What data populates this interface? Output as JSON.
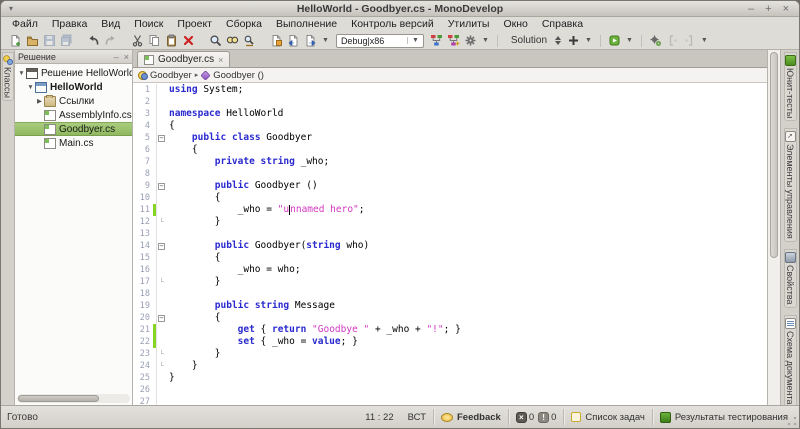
{
  "window": {
    "title": "HelloWorld - Goodbyer.cs - MonoDevelop",
    "minimize": "–",
    "maximize": "+",
    "close": "×",
    "menu_glyph": "▾"
  },
  "menubar": {
    "items": [
      "Файл",
      "Правка",
      "Вид",
      "Поиск",
      "Проект",
      "Сборка",
      "Выполнение",
      "Контроль версий",
      "Утилиты",
      "Окно",
      "Справка"
    ]
  },
  "toolbar": {
    "debug_config": "Debug|x86",
    "solution_label": "Solution",
    "items": [
      {
        "t": "i",
        "n": "new-file-icon"
      },
      {
        "t": "i",
        "n": "open-file-icon"
      },
      {
        "t": "i",
        "n": "save-icon",
        "d": 1
      },
      {
        "t": "i",
        "n": "save-all-icon",
        "d": 1
      },
      {
        "t": "gap"
      },
      {
        "t": "i",
        "n": "undo-icon"
      },
      {
        "t": "i",
        "n": "redo-icon",
        "d": 1
      },
      {
        "t": "gap"
      },
      {
        "t": "i",
        "n": "cut-icon"
      },
      {
        "t": "i",
        "n": "copy-icon"
      },
      {
        "t": "i",
        "n": "paste-icon"
      },
      {
        "t": "i",
        "n": "delete-icon"
      },
      {
        "t": "gap"
      },
      {
        "t": "i",
        "n": "search-icon"
      },
      {
        "t": "i",
        "n": "find-in-files-icon"
      },
      {
        "t": "i",
        "n": "find-replace-icon"
      },
      {
        "t": "gap"
      },
      {
        "t": "i",
        "n": "file-history-icon"
      },
      {
        "t": "i",
        "n": "prev-document-icon"
      },
      {
        "t": "i",
        "n": "next-document-icon"
      },
      {
        "t": "dd",
        "n": "navigation-dropdown-icon"
      },
      {
        "t": "combo"
      },
      {
        "t": "i",
        "n": "debug-threads-icon"
      },
      {
        "t": "i",
        "n": "debug-callstack-icon"
      },
      {
        "t": "i",
        "n": "gear-icon"
      },
      {
        "t": "dd",
        "n": "run-options-dropdown-icon"
      },
      {
        "t": "sep"
      },
      {
        "t": "sol"
      },
      {
        "t": "spin"
      },
      {
        "t": "i",
        "n": "add-icon"
      },
      {
        "t": "dd",
        "n": "add-dropdown-icon"
      },
      {
        "t": "sep"
      },
      {
        "t": "i",
        "n": "run-package-icon"
      },
      {
        "t": "dd",
        "n": "package-dropdown-icon"
      },
      {
        "t": "sep"
      },
      {
        "t": "i",
        "n": "build-gear-icon"
      },
      {
        "t": "i",
        "n": "bracket-open-icon",
        "d": 1
      },
      {
        "t": "i",
        "n": "bracket-close-icon",
        "d": 1
      },
      {
        "t": "dd",
        "n": "tools-dropdown-icon"
      }
    ]
  },
  "left_dock": {
    "tabs": [
      {
        "label": "Классы",
        "icon": "classes-icon"
      }
    ]
  },
  "solution_panel": {
    "title": "Решение",
    "minimize_glyph": "–",
    "close_glyph": "×",
    "tree": [
      {
        "label": "Решение HelloWorld",
        "level": 0,
        "expander": "▼",
        "icon": "solution",
        "bold": false,
        "selected": false
      },
      {
        "label": "HelloWorld",
        "level": 1,
        "expander": "▼",
        "icon": "project",
        "bold": true,
        "selected": false
      },
      {
        "label": "Ссылки",
        "level": 2,
        "expander": "▶",
        "icon": "references",
        "bold": false,
        "selected": false
      },
      {
        "label": "AssemblyInfo.cs",
        "level": 2,
        "expander": "",
        "icon": "cs-file",
        "bold": false,
        "selected": false
      },
      {
        "label": "Goodbyer.cs",
        "level": 2,
        "expander": "",
        "icon": "cs-file",
        "bold": false,
        "selected": true
      },
      {
        "label": "Main.cs",
        "level": 2,
        "expander": "",
        "icon": "cs-file",
        "bold": false,
        "selected": false
      }
    ]
  },
  "editor": {
    "tab": {
      "title": "Goodbyer.cs",
      "close_glyph": "×"
    },
    "breadcrumb": [
      {
        "icon": "class-icon",
        "label": "Goodbyer",
        "arrow": "▸"
      },
      {
        "icon": "method-icon",
        "label": "Goodbyer ()",
        "arrow": ""
      }
    ],
    "code": {
      "fold_open_lines": [
        5,
        9,
        14,
        20
      ],
      "fold_end_lines": [
        12,
        17,
        23,
        24
      ],
      "changed_lines": [
        11,
        21,
        22
      ],
      "lines": [
        [
          [
            "k",
            "using"
          ],
          [
            "p",
            " System;"
          ]
        ],
        [],
        [
          [
            "k",
            "namespace"
          ],
          [
            "p",
            " HelloWorld"
          ]
        ],
        [
          [
            "p",
            "{"
          ]
        ],
        [
          [
            "p",
            "    "
          ],
          [
            "k",
            "public"
          ],
          [
            "p",
            " "
          ],
          [
            "k",
            "class"
          ],
          [
            "p",
            " Goodbyer"
          ]
        ],
        [
          [
            "p",
            "    {"
          ]
        ],
        [
          [
            "p",
            "        "
          ],
          [
            "k",
            "private"
          ],
          [
            "p",
            " "
          ],
          [
            "k",
            "string"
          ],
          [
            "p",
            " _who;"
          ]
        ],
        [],
        [
          [
            "p",
            "        "
          ],
          [
            "k",
            "public"
          ],
          [
            "p",
            " Goodbyer ()"
          ]
        ],
        [
          [
            "p",
            "        {"
          ]
        ],
        [
          [
            "p",
            "            _who = "
          ],
          [
            "s",
            "\"u"
          ],
          [
            "c",
            ""
          ],
          [
            "s",
            "nnamed hero\""
          ],
          [
            "p",
            ";"
          ]
        ],
        [
          [
            "p",
            "        }"
          ]
        ],
        [],
        [
          [
            "p",
            "        "
          ],
          [
            "k",
            "public"
          ],
          [
            "p",
            " Goodbyer("
          ],
          [
            "k",
            "string"
          ],
          [
            "p",
            " who)"
          ]
        ],
        [
          [
            "p",
            "        {"
          ]
        ],
        [
          [
            "p",
            "            _who = who;"
          ]
        ],
        [
          [
            "p",
            "        }"
          ]
        ],
        [],
        [
          [
            "p",
            "        "
          ],
          [
            "k",
            "public"
          ],
          [
            "p",
            " "
          ],
          [
            "k",
            "string"
          ],
          [
            "p",
            " Message"
          ]
        ],
        [
          [
            "p",
            "        {"
          ]
        ],
        [
          [
            "p",
            "            "
          ],
          [
            "k",
            "get"
          ],
          [
            "p",
            " { "
          ],
          [
            "k",
            "return"
          ],
          [
            "p",
            " "
          ],
          [
            "s",
            "\"Goodbye \""
          ],
          [
            "p",
            " + _who + "
          ],
          [
            "s",
            "\"!\""
          ],
          [
            "p",
            "; }"
          ]
        ],
        [
          [
            "p",
            "            "
          ],
          [
            "k",
            "set"
          ],
          [
            "p",
            " { _who = "
          ],
          [
            "k",
            "value"
          ],
          [
            "p",
            "; }"
          ]
        ],
        [
          [
            "p",
            "        }"
          ]
        ],
        [
          [
            "p",
            "    }"
          ]
        ],
        [
          [
            "p",
            "}"
          ]
        ],
        [],
        []
      ]
    }
  },
  "right_dock": {
    "tabs": [
      {
        "label": "Юнит-тесты",
        "icon": "unit-tests-icon",
        "cls": "ri-unit"
      },
      {
        "label": "Элементы управления",
        "icon": "ui-elements-icon",
        "cls": "ri-elem"
      },
      {
        "label": "Свойства",
        "icon": "properties-icon",
        "cls": "ri-prop"
      },
      {
        "label": "Схема документа",
        "icon": "document-outline-icon",
        "cls": "ri-schema"
      }
    ]
  },
  "statusbar": {
    "status": "Готово",
    "caret_position": "11 : 22",
    "insert_mode": "ВСТ",
    "feedback_label": "Feedback",
    "error_count": "0",
    "warning_count": "0",
    "tasks_label": "Список задач",
    "tests_label": "Результаты тестирования"
  },
  "colors": {
    "keyword": "#2929cf",
    "string": "#d338c0",
    "plain": "#000000",
    "line_number": "#9aa0b4",
    "changed_bar": "#85d426",
    "tree_selection": "#9cc16c"
  }
}
